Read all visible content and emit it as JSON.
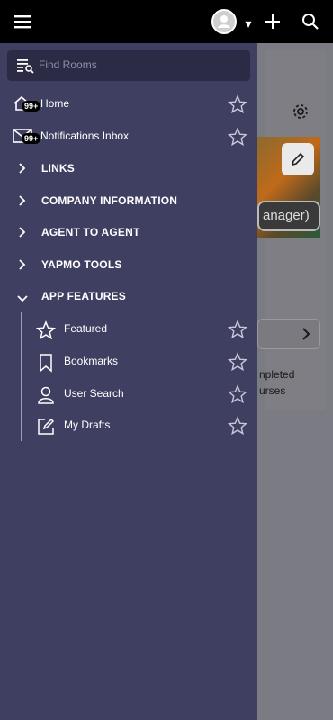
{
  "topbar": {
    "icons": [
      "menu-icon",
      "avatar-icon",
      "caret-down-icon",
      "plus-icon",
      "search-icon"
    ],
    "caret": "▾"
  },
  "drawer": {
    "search_placeholder": "Find Rooms",
    "items": [
      {
        "label": "Home",
        "badge": "99+",
        "icon": "home-icon"
      },
      {
        "label": "Notifications Inbox",
        "badge": "99+",
        "icon": "mail-icon"
      }
    ],
    "sections": [
      {
        "label": "LINKS",
        "expanded": false
      },
      {
        "label": "COMPANY INFORMATION",
        "expanded": false
      },
      {
        "label": "AGENT TO AGENT",
        "expanded": false
      },
      {
        "label": "YAPMO TOOLS",
        "expanded": false
      },
      {
        "label": "APP FEATURES",
        "expanded": true
      }
    ],
    "features": [
      {
        "label": "Featured",
        "icon": "star-icon"
      },
      {
        "label": "Bookmarks",
        "icon": "bookmark-icon"
      },
      {
        "label": "User Search",
        "icon": "user-icon"
      },
      {
        "label": "My Drafts",
        "icon": "edit-icon"
      }
    ]
  },
  "background": {
    "role_text": "anager)",
    "line1": "npleted",
    "line2": "urses"
  },
  "colors": {
    "drawer_bg": "#3f3f62",
    "search_bg": "#2b2b46",
    "topbar_bg": "#000000"
  }
}
